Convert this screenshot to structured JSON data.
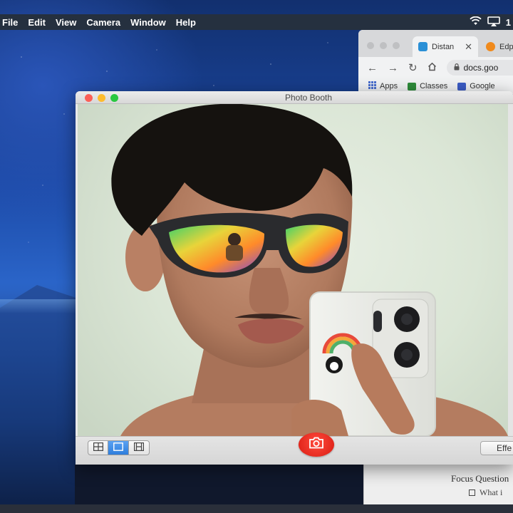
{
  "menubar": {
    "items": [
      "File",
      "Edit",
      "View",
      "Camera",
      "Window",
      "Help"
    ],
    "clock_fragment": "1"
  },
  "chrome": {
    "tabs": [
      {
        "label": "Distan",
        "favicon_color": "#2a8fd6"
      },
      {
        "label": "Edp",
        "favicon_color": "#f08a1c"
      }
    ],
    "address": "docs.goo",
    "bookmarks": [
      {
        "label": "Apps",
        "icon_color": "#4a6fd0"
      },
      {
        "label": "Classes",
        "icon_color": "#2e8b3a"
      },
      {
        "label": "Google",
        "icon_color": "#3b5bc4"
      }
    ]
  },
  "photobooth": {
    "title": "Photo Booth",
    "effects_label": "Effe",
    "view_modes": [
      "grid-view-icon",
      "single-photo-icon",
      "filmstrip-icon"
    ],
    "selected_view": 1
  },
  "document": {
    "heading": "Focus Question",
    "item": "What i"
  },
  "colors": {
    "close": "#fc5f57",
    "minimize": "#fdbc2e",
    "zoom": "#29c840",
    "shutter": "#e8261c",
    "selected_segment": "#3b8ae6"
  }
}
